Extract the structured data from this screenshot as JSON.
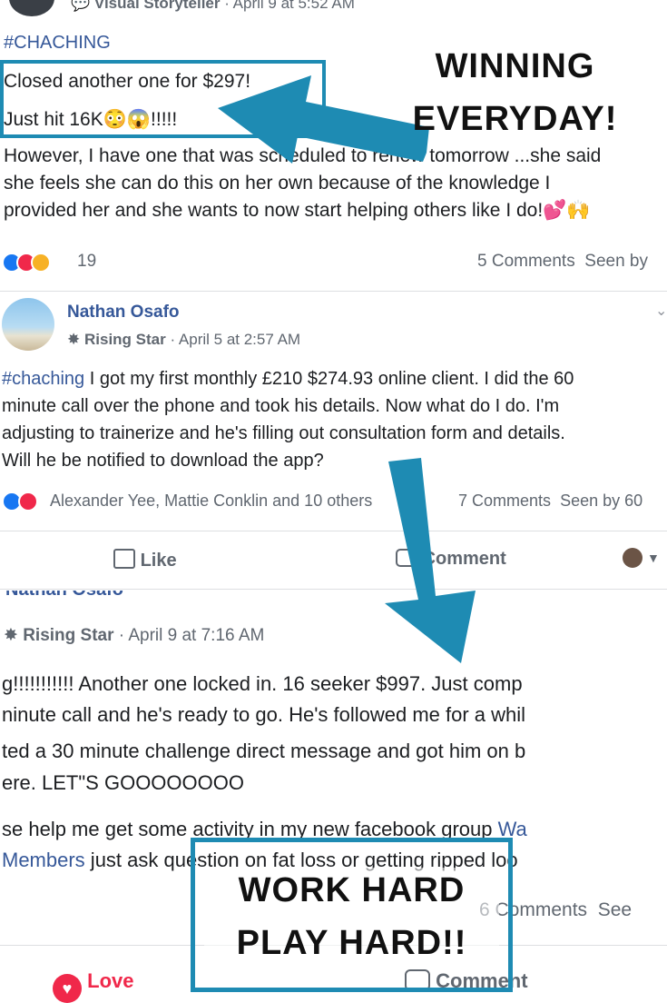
{
  "post1": {
    "author_badge": "Visual Storyteller",
    "timestamp": "April 9 at 5:52 AM",
    "hashtag": "#CHACHING",
    "line1": "Closed another one for $297!",
    "line2_prefix": "Just hit 16K",
    "line2_suffix": "!!!!!",
    "line3": "However, I have one that was scheduled to renew tomorrow ...she said",
    "line4": "she feels she can do this on her own because of the knowledge I",
    "line5": "provided her and she wants to now start helping others like I do!",
    "reaction_count": "19",
    "comments": "5 Comments",
    "seen_by": "Seen by"
  },
  "post2": {
    "author": "Nathan Osafo",
    "badge": "Rising Star",
    "timestamp": "April 5 at 2:57 AM",
    "hashtag": "#chaching",
    "line1_rest": " I got my first monthly £210 $274.93 online client. I did the 60",
    "line2": "minute call over the phone and took his details. Now what do I do. I'm",
    "line3": "adjusting to trainerize and he's filling out consultation form and details.",
    "line4": "Will he be notified to download the app?",
    "reactors": "Alexander Yee, Mattie Conklin and 10 others",
    "comments": "7 Comments",
    "seen_by": "Seen by 60",
    "like_label": "Like",
    "comment_label": "Comment"
  },
  "post3": {
    "author_partial": "Nathan Osafo",
    "badge": "Rising Star",
    "timestamp": "April 9 at 7:16 AM",
    "line1": "g!!!!!!!!!!! Another one locked in. 16 seeker $997. Just comp",
    "line2": "ninute call and he's ready to go. He's followed me for a whil",
    "line3": "ted a 30 minute challenge direct message and got him on b",
    "line4": "ere. LET\"S GOOOOOOOO",
    "line5_prefix": "se help me get some activity in my new facebook group ",
    "line5_link": "Wa",
    "line6_link": "Members",
    "line6_rest": " just ask question on fat loss or getting ripped loo",
    "comments": "6 Comments",
    "seen_by": "See",
    "love_label": "Love",
    "comment_label": "Comment"
  },
  "callouts": {
    "winning_line1": "WINNING",
    "winning_line2": "EVERYDAY!",
    "work_line1": "WORK HARD",
    "work_line2": "PLAY HARD!!"
  },
  "colors": {
    "accent": "#1e8bb3",
    "fb_link": "#365899",
    "like_blue": "#1877f2",
    "love_red": "#f0284a"
  }
}
